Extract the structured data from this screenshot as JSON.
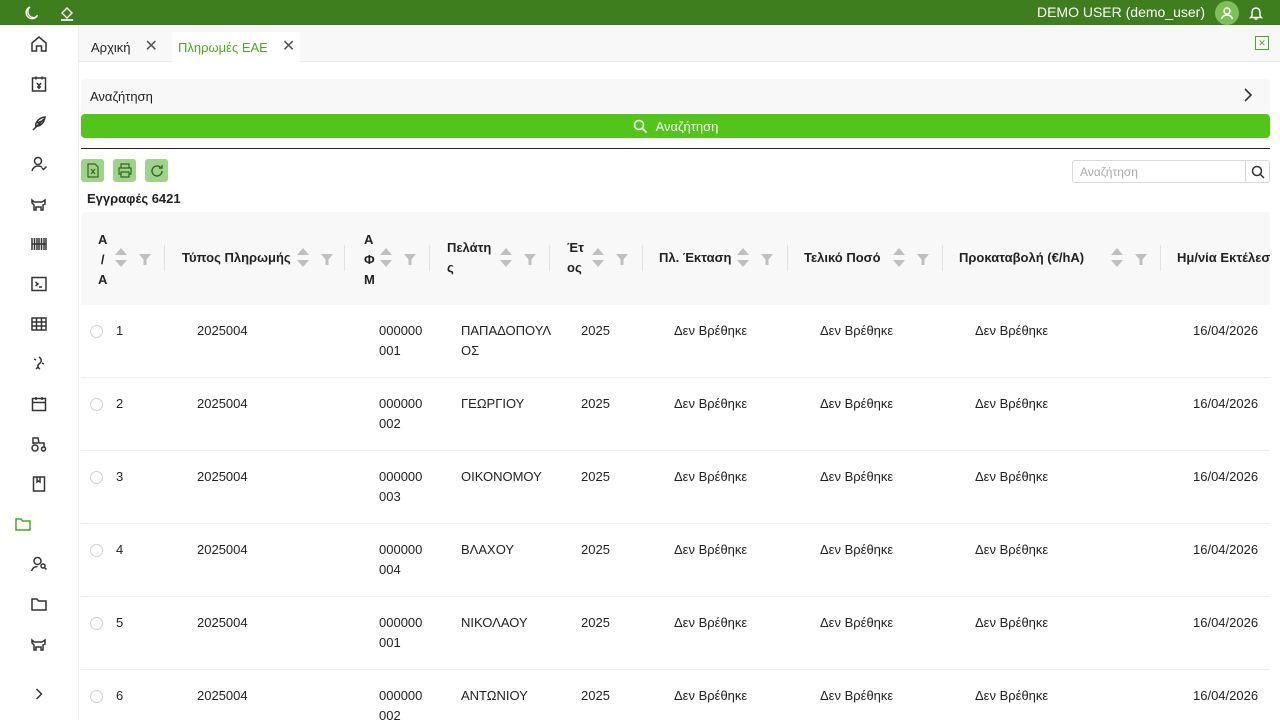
{
  "topbar": {
    "user": "DEMO USER (demo_user)",
    "color": "#3e7e1e",
    "icons": [
      "moon-icon",
      "fill-icon",
      "avatar-icon",
      "bell-icon"
    ]
  },
  "sidebar": {
    "items": [
      "home",
      "invoice",
      "feather",
      "user",
      "cow",
      "barcode",
      "terminal",
      "table",
      "germ",
      "calendar",
      "tractor",
      "book",
      "folder",
      "user-search",
      "folder",
      "cow"
    ],
    "active_index": 12,
    "expand": "chevron-right"
  },
  "tabs": [
    {
      "label": "Αρχική",
      "active": false
    },
    {
      "label": "Πληρωμές ΕΑΕ",
      "active": true
    }
  ],
  "search_panel": {
    "label": "Αναζήτηση",
    "button_label": "Αναζήτηση"
  },
  "grid": {
    "records_label": "Εγγραφές 6421",
    "search_placeholder": "Αναζήτηση",
    "tools": [
      "excel-export",
      "print",
      "refresh"
    ]
  },
  "table": {
    "columns": [
      {
        "label": "Α\nΑ",
        "key": "aa"
      },
      {
        "label": "Τύπος Πληρωμής",
        "key": "type"
      },
      {
        "label": "Α\nΦ\nΜ",
        "key": "afm"
      },
      {
        "label": "Πελάτη\nς",
        "key": "client"
      },
      {
        "label": "Έτ\nος",
        "key": "year"
      },
      {
        "label": "Πλ. Έκταση",
        "key": "area"
      },
      {
        "label": "Τελικό Ποσό",
        "key": "amount"
      },
      {
        "label": "Προκαταβολή (€/hA)",
        "key": "advance"
      },
      {
        "label": "Ημ/νία Εκτέλεσ",
        "key": "date"
      }
    ],
    "header_first_col": "Α\n/\nΑ",
    "rows": [
      {
        "aa": "1",
        "type": "2025004",
        "afm1": "000000",
        "afm2": "001",
        "client1": "ΠΑΠΑΔΟΠΟΥΛ",
        "client2": "ΟΣ",
        "year": "2025",
        "area": "Δεν Βρέθηκε",
        "amount": "Δεν Βρέθηκε",
        "advance": "Δεν Βρέθηκε",
        "date": "16/04/2026"
      },
      {
        "aa": "2",
        "type": "2025004",
        "afm1": "000000",
        "afm2": "002",
        "client1": "ΓΕΩΡΓΙΟΥ",
        "client2": "",
        "year": "2025",
        "area": "Δεν Βρέθηκε",
        "amount": "Δεν Βρέθηκε",
        "advance": "Δεν Βρέθηκε",
        "date": "16/04/2026"
      },
      {
        "aa": "3",
        "type": "2025004",
        "afm1": "000000",
        "afm2": "003",
        "client1": "ΟΙΚΟΝΟΜΟΥ",
        "client2": "",
        "year": "2025",
        "area": "Δεν Βρέθηκε",
        "amount": "Δεν Βρέθηκε",
        "advance": "Δεν Βρέθηκε",
        "date": "16/04/2026"
      },
      {
        "aa": "4",
        "type": "2025004",
        "afm1": "000000",
        "afm2": "004",
        "client1": "ΒΛΑΧΟΥ",
        "client2": "",
        "year": "2025",
        "area": "Δεν Βρέθηκε",
        "amount": "Δεν Βρέθηκε",
        "advance": "Δεν Βρέθηκε",
        "date": "16/04/2026"
      },
      {
        "aa": "5",
        "type": "2025004",
        "afm1": "000000",
        "afm2": "001",
        "client1": "ΝΙΚΟΛΑΟΥ",
        "client2": "",
        "year": "2025",
        "area": "Δεν Βρέθηκε",
        "amount": "Δεν Βρέθηκε",
        "advance": "Δεν Βρέθηκε",
        "date": "16/04/2026"
      },
      {
        "aa": "6",
        "type": "2025004",
        "afm1": "000000",
        "afm2": "002",
        "client1": "ΑΝΤΩΝΙΟΥ",
        "client2": "",
        "year": "2025",
        "area": "Δεν Βρέθηκε",
        "amount": "Δεν Βρέθηκε",
        "advance": "Δεν Βρέθηκε",
        "date": "16/04/2026"
      }
    ]
  },
  "colors": {
    "accent": "#52c41a",
    "accent_dark": "#4aa81e"
  }
}
